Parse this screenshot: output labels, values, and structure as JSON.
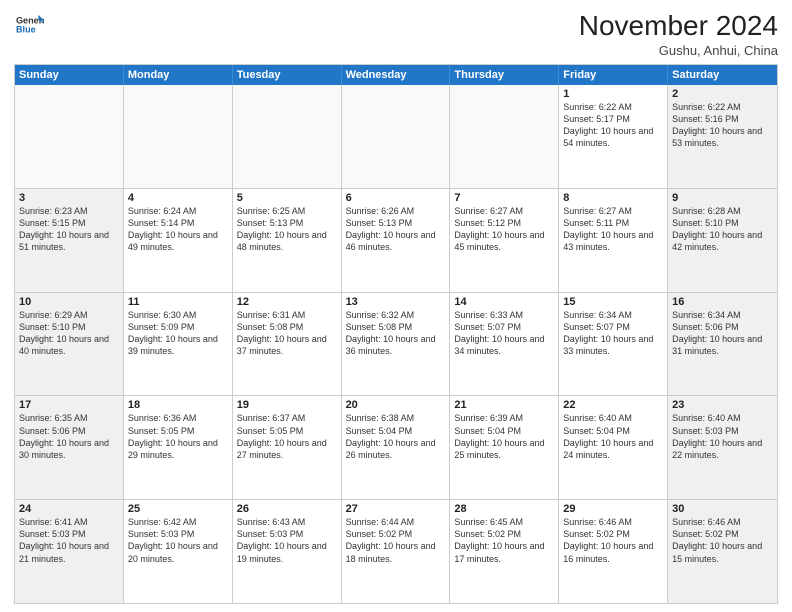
{
  "logo": {
    "general": "General",
    "blue": "Blue"
  },
  "header": {
    "month": "November 2024",
    "location": "Gushu, Anhui, China"
  },
  "days": [
    "Sunday",
    "Monday",
    "Tuesday",
    "Wednesday",
    "Thursday",
    "Friday",
    "Saturday"
  ],
  "rows": [
    [
      {
        "day": "",
        "empty": true
      },
      {
        "day": "",
        "empty": true
      },
      {
        "day": "",
        "empty": true
      },
      {
        "day": "",
        "empty": true
      },
      {
        "day": "",
        "empty": true
      },
      {
        "day": "1",
        "sunrise": "6:22 AM",
        "sunset": "5:17 PM",
        "daylight": "10 hours and 54 minutes."
      },
      {
        "day": "2",
        "sunrise": "6:22 AM",
        "sunset": "5:16 PM",
        "daylight": "10 hours and 53 minutes."
      }
    ],
    [
      {
        "day": "3",
        "sunrise": "6:23 AM",
        "sunset": "5:15 PM",
        "daylight": "10 hours and 51 minutes."
      },
      {
        "day": "4",
        "sunrise": "6:24 AM",
        "sunset": "5:14 PM",
        "daylight": "10 hours and 49 minutes."
      },
      {
        "day": "5",
        "sunrise": "6:25 AM",
        "sunset": "5:13 PM",
        "daylight": "10 hours and 48 minutes."
      },
      {
        "day": "6",
        "sunrise": "6:26 AM",
        "sunset": "5:13 PM",
        "daylight": "10 hours and 46 minutes."
      },
      {
        "day": "7",
        "sunrise": "6:27 AM",
        "sunset": "5:12 PM",
        "daylight": "10 hours and 45 minutes."
      },
      {
        "day": "8",
        "sunrise": "6:27 AM",
        "sunset": "5:11 PM",
        "daylight": "10 hours and 43 minutes."
      },
      {
        "day": "9",
        "sunrise": "6:28 AM",
        "sunset": "5:10 PM",
        "daylight": "10 hours and 42 minutes."
      }
    ],
    [
      {
        "day": "10",
        "sunrise": "6:29 AM",
        "sunset": "5:10 PM",
        "daylight": "10 hours and 40 minutes."
      },
      {
        "day": "11",
        "sunrise": "6:30 AM",
        "sunset": "5:09 PM",
        "daylight": "10 hours and 39 minutes."
      },
      {
        "day": "12",
        "sunrise": "6:31 AM",
        "sunset": "5:08 PM",
        "daylight": "10 hours and 37 minutes."
      },
      {
        "day": "13",
        "sunrise": "6:32 AM",
        "sunset": "5:08 PM",
        "daylight": "10 hours and 36 minutes."
      },
      {
        "day": "14",
        "sunrise": "6:33 AM",
        "sunset": "5:07 PM",
        "daylight": "10 hours and 34 minutes."
      },
      {
        "day": "15",
        "sunrise": "6:34 AM",
        "sunset": "5:07 PM",
        "daylight": "10 hours and 33 minutes."
      },
      {
        "day": "16",
        "sunrise": "6:34 AM",
        "sunset": "5:06 PM",
        "daylight": "10 hours and 31 minutes."
      }
    ],
    [
      {
        "day": "17",
        "sunrise": "6:35 AM",
        "sunset": "5:06 PM",
        "daylight": "10 hours and 30 minutes."
      },
      {
        "day": "18",
        "sunrise": "6:36 AM",
        "sunset": "5:05 PM",
        "daylight": "10 hours and 29 minutes."
      },
      {
        "day": "19",
        "sunrise": "6:37 AM",
        "sunset": "5:05 PM",
        "daylight": "10 hours and 27 minutes."
      },
      {
        "day": "20",
        "sunrise": "6:38 AM",
        "sunset": "5:04 PM",
        "daylight": "10 hours and 26 minutes."
      },
      {
        "day": "21",
        "sunrise": "6:39 AM",
        "sunset": "5:04 PM",
        "daylight": "10 hours and 25 minutes."
      },
      {
        "day": "22",
        "sunrise": "6:40 AM",
        "sunset": "5:04 PM",
        "daylight": "10 hours and 24 minutes."
      },
      {
        "day": "23",
        "sunrise": "6:40 AM",
        "sunset": "5:03 PM",
        "daylight": "10 hours and 22 minutes."
      }
    ],
    [
      {
        "day": "24",
        "sunrise": "6:41 AM",
        "sunset": "5:03 PM",
        "daylight": "10 hours and 21 minutes."
      },
      {
        "day": "25",
        "sunrise": "6:42 AM",
        "sunset": "5:03 PM",
        "daylight": "10 hours and 20 minutes."
      },
      {
        "day": "26",
        "sunrise": "6:43 AM",
        "sunset": "5:03 PM",
        "daylight": "10 hours and 19 minutes."
      },
      {
        "day": "27",
        "sunrise": "6:44 AM",
        "sunset": "5:02 PM",
        "daylight": "10 hours and 18 minutes."
      },
      {
        "day": "28",
        "sunrise": "6:45 AM",
        "sunset": "5:02 PM",
        "daylight": "10 hours and 17 minutes."
      },
      {
        "day": "29",
        "sunrise": "6:46 AM",
        "sunset": "5:02 PM",
        "daylight": "10 hours and 16 minutes."
      },
      {
        "day": "30",
        "sunrise": "6:46 AM",
        "sunset": "5:02 PM",
        "daylight": "10 hours and 15 minutes."
      }
    ]
  ]
}
